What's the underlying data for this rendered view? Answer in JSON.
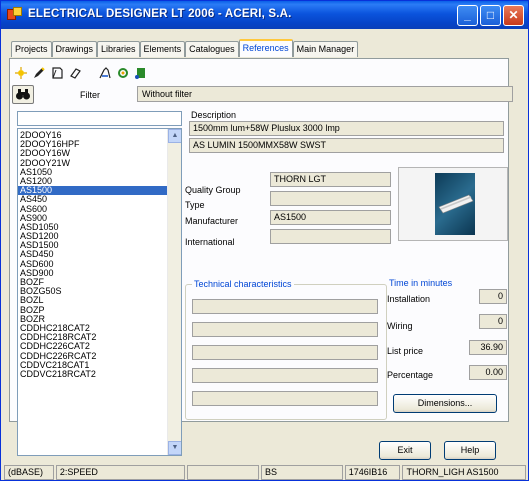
{
  "window": {
    "title": "ELECTRICAL DESIGNER LT 2006 - ACERI, S.A.",
    "min": "_",
    "max": "□",
    "close": "✕"
  },
  "tabs": [
    "Projects",
    "Drawings",
    "Libraries",
    "Elements",
    "Catalogues",
    "References",
    "Main Manager"
  ],
  "active_tab": "References",
  "toolbar": {
    "icons": [
      "new-icon",
      "edit-icon",
      "open-icon",
      "erase-icon",
      "filter-tool-icon",
      "refresh-icon",
      "export-icon"
    ]
  },
  "filter": {
    "label": "Filter",
    "value": "Without filter"
  },
  "search": {
    "value": ""
  },
  "list": {
    "items": [
      "2DOOY16",
      "2DOOY16HPF",
      "2DOOY16W",
      "2DOOY21W",
      "AS1050",
      "AS1200",
      "AS1500",
      "AS450",
      "AS600",
      "AS900",
      "ASD1050",
      "ASD1200",
      "ASD1500",
      "ASD450",
      "ASD600",
      "ASD900",
      "BOZF",
      "BOZG50S",
      "BOZL",
      "BOZP",
      "BOZR",
      "CDDHC218CAT2",
      "CDDHC218RCAT2",
      "CDDHC226CAT2",
      "CDDHC226RCAT2",
      "CDDVC218CAT1",
      "CDDVC218RCAT2"
    ],
    "selected": "AS1500"
  },
  "description": {
    "label": "Description",
    "line1": "1500mm lum+58W Pluslux 3000 lmp",
    "line2": "AS LUMIN 1500MMX58W SWST"
  },
  "properties": {
    "quality_group_label": "Quality Group",
    "quality_group": "THORN LGT",
    "type_label": "Type",
    "type": "",
    "manufacturer_label": "Manufacturer",
    "manufacturer": "AS1500",
    "international_label": "International",
    "international": ""
  },
  "technical": {
    "title": "Technical characteristics"
  },
  "time": {
    "title": "Time in minutes",
    "installation_label": "Installation",
    "installation": "0",
    "wiring_label": "Wiring",
    "wiring": "0",
    "list_price_label": "List price",
    "list_price": "36.90",
    "percentage_label": "Percentage",
    "percentage": "0.00",
    "dimensions_button": "Dimensions..."
  },
  "buttons": {
    "exit": "Exit",
    "help": "Help"
  },
  "status": {
    "db": "(dBASE)",
    "mode": "2:SPEED",
    "empty": "",
    "code1": "BS",
    "code2": "1746IB16",
    "ref": "THORN_LIGH AS1500"
  }
}
